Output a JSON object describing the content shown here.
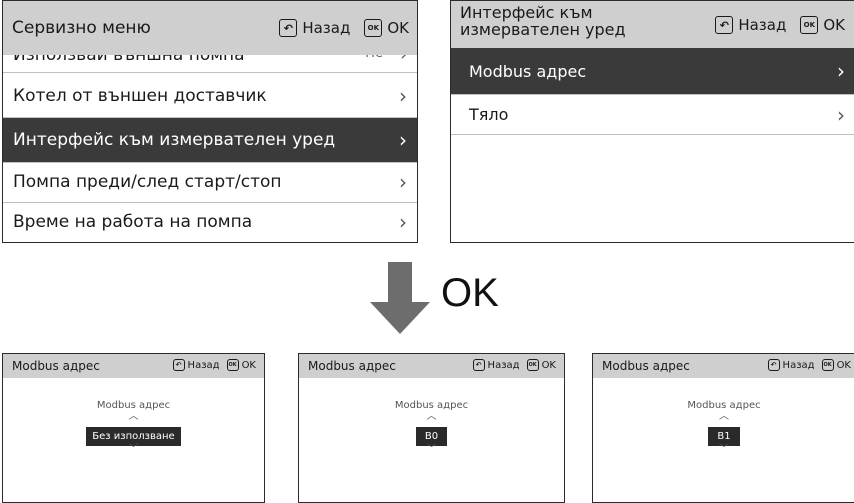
{
  "header_common": {
    "back_label": "Назад",
    "ok_label": "OK",
    "back_icon": "back-arrow-icon",
    "ok_icon": "ok-key-icon"
  },
  "panel_service": {
    "title": "Сервизно меню",
    "items": [
      {
        "label": "Използвай външна помпа",
        "value": "Не",
        "selected": false
      },
      {
        "label": "Котел от външен доставчик",
        "selected": false
      },
      {
        "label": "Интерфейс към измервателен уред",
        "selected": true
      },
      {
        "label": "Помпа преди/след старт/стоп",
        "selected": false
      },
      {
        "label": "Време на работа на помпа",
        "selected": false
      }
    ]
  },
  "panel_meter": {
    "title": "Интерфейс към измервателен уред",
    "items": [
      {
        "label": "Modbus адрес",
        "selected": true
      },
      {
        "label": "Тяло",
        "selected": false
      }
    ]
  },
  "transition": {
    "label": "OK"
  },
  "modbus_screens": [
    {
      "title": "Modbus адрес",
      "caption": "Modbus адрес",
      "value": "Без използване"
    },
    {
      "title": "Modbus адрес",
      "caption": "Modbus адрес",
      "value": "B0"
    },
    {
      "title": "Modbus адрес",
      "caption": "Modbus адрес",
      "value": "B1"
    }
  ],
  "colors": {
    "header_bg": "#cfcfcf",
    "selected_bg": "#3a3a3a",
    "arrow": "#6d6d6d",
    "value_bg": "#2a2a2a"
  }
}
